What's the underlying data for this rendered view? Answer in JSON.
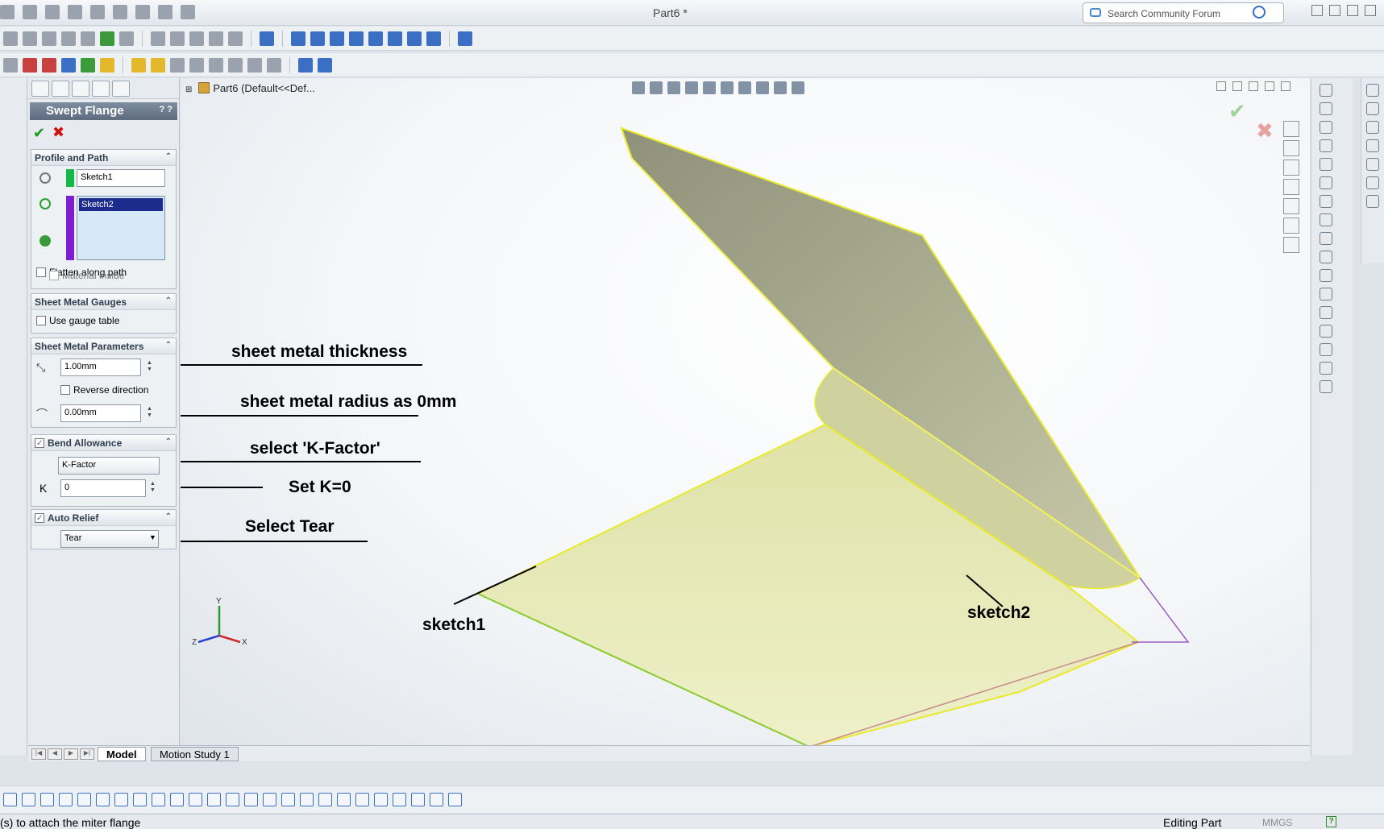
{
  "app": {
    "document_title": "Part6 *",
    "search": {
      "placeholder": "Search Community Forum"
    }
  },
  "feature_tree": {
    "root_label": "Part6  (Default<<Def..."
  },
  "property_manager": {
    "title": "Swept Flange",
    "help_icons": "? ?",
    "profile_and_path": {
      "header": "Profile and Path",
      "profile_value": "Sketch1",
      "path_value": "Sketch2",
      "flatten_label": "Flatten along path",
      "material_inside_label": "Material inside"
    },
    "sheet_metal_gauges": {
      "header": "Sheet Metal Gauges",
      "use_gauge_label": "Use gauge table"
    },
    "sheet_metal_parameters": {
      "header": "Sheet Metal Parameters",
      "thickness": "1.00mm",
      "reverse_label": "Reverse direction",
      "radius": "0.00mm"
    },
    "bend_allowance": {
      "header": "Bend Allowance",
      "type": "K-Factor",
      "k_label": "K",
      "k_value": "0"
    },
    "auto_relief": {
      "header": "Auto Relief",
      "type": "Tear"
    }
  },
  "annotations": {
    "thickness": "sheet metal thickness",
    "radius": "sheet metal radius as 0mm",
    "kfactor": "select 'K-Factor'",
    "k0": "Set K=0",
    "tear": "Select Tear",
    "sketch1": "sketch1",
    "sketch2": "sketch2"
  },
  "triad": {
    "x": "X",
    "y": "Y",
    "z": "Z"
  },
  "bottom_tabs": {
    "model": "Model",
    "motion": "Motion Study 1"
  },
  "status": {
    "message": "(s) to attach the miter flange",
    "mode": "Editing Part",
    "units": "MMGS",
    "help": "?"
  },
  "colors": {
    "selection_yellow": "#e8ea2a",
    "face_fill": "#e6e9b0",
    "pm_header": "#5c6b7d"
  }
}
